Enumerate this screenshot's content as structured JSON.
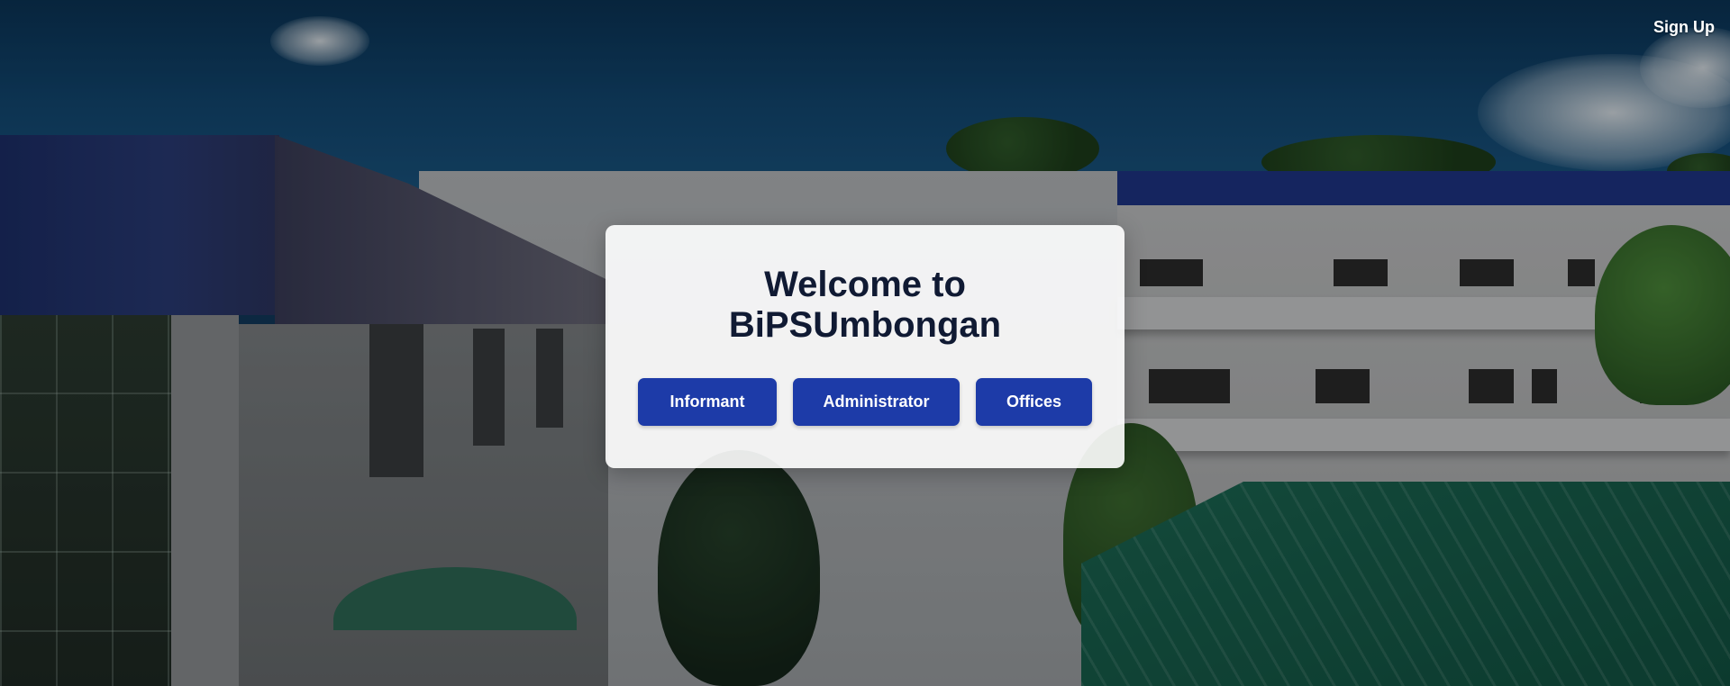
{
  "nav": {
    "signup_label": "Sign Up"
  },
  "welcome_card": {
    "title_line1": "Welcome to",
    "title_line2": "BiPSUmbongan",
    "buttons": [
      {
        "label": "Informant"
      },
      {
        "label": "Administrator"
      },
      {
        "label": "Offices"
      }
    ]
  },
  "colors": {
    "button_bg": "#1d3ba8",
    "title_text": "#101a33",
    "card_bg": "#ffffff"
  }
}
